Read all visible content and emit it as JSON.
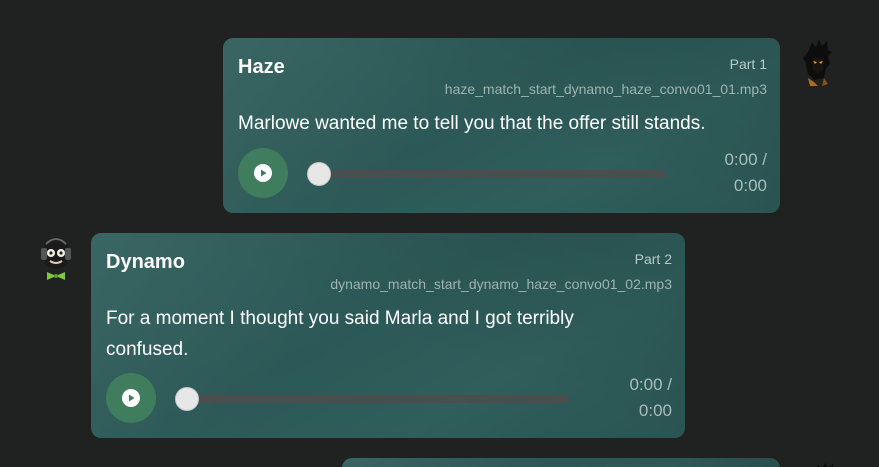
{
  "messages": [
    {
      "speaker": "Haze",
      "part": "Part 1",
      "filename": "haze_match_start_dynamo_haze_convo01_01.mp3",
      "lines": [
        "Marlowe wanted me to tell you that the offer still stands."
      ],
      "time_line1": "0:00 /",
      "time_line2": "0:00",
      "progress": 0
    },
    {
      "speaker": "Dynamo",
      "part": "Part 2",
      "filename": "dynamo_match_start_dynamo_haze_convo01_02.mp3",
      "lines": [
        "For a moment I thought you said Marla and I got terribly",
        "confused."
      ],
      "time_line1": "0:00 /",
      "time_line2": "0:00",
      "progress": 0
    }
  ],
  "colors": {
    "background": "#202121",
    "bubble": "#2f5e5b",
    "play_button": "#3f7d5e",
    "track": "#4a4e4e",
    "thumb": "#e7e7e7"
  },
  "icons": {
    "play": "play-icon",
    "avatar_haze": "haze-avatar",
    "avatar_dynamo": "dynamo-avatar"
  }
}
